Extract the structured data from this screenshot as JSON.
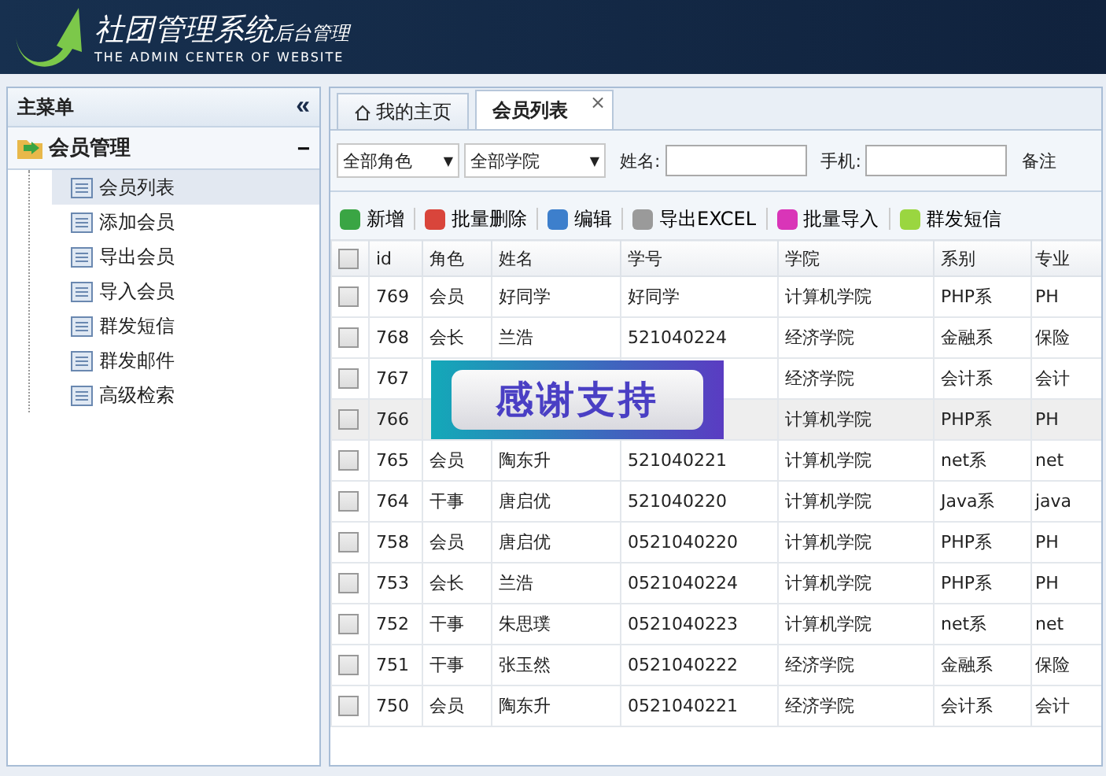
{
  "header": {
    "title": "社团管理系统",
    "subtitle": "后台管理",
    "tagline": "THE ADMIN CENTER OF WEBSITE"
  },
  "sidebar": {
    "title": "主菜单",
    "collapse": "«",
    "group": {
      "label": "会员管理",
      "expanded": true,
      "toggle": "−",
      "items": [
        {
          "label": "会员列表",
          "selected": true
        },
        {
          "label": "添加会员",
          "selected": false
        },
        {
          "label": "导出会员",
          "selected": false
        },
        {
          "label": "导入会员",
          "selected": false
        },
        {
          "label": "群发短信",
          "selected": false
        },
        {
          "label": "群发邮件",
          "selected": false
        },
        {
          "label": "高级检索",
          "selected": false
        }
      ]
    }
  },
  "tabs": [
    {
      "label": "我的主页",
      "selected": false,
      "kind": "home"
    },
    {
      "label": "会员列表",
      "selected": true,
      "kind": "closable",
      "close": "×"
    }
  ],
  "filters": {
    "role": "全部角色",
    "college": "全部学院",
    "caret": "▼",
    "name_label": "姓名:",
    "phone_label": "手机:",
    "note_label": "备注"
  },
  "toolbar": [
    {
      "label": "新增",
      "color": "#3aa544"
    },
    {
      "label": "批量删除",
      "color": "#d9453b"
    },
    {
      "label": "编辑",
      "color": "#3d7fcc"
    },
    {
      "label": "导出EXCEL",
      "color": "#9a9a9a"
    },
    {
      "label": "批量导入",
      "color": "#d935b8"
    },
    {
      "label": "群发短信",
      "color": "#9ad640"
    }
  ],
  "table": {
    "select_all": false,
    "columns": [
      "id",
      "角色",
      "姓名",
      "学号",
      "学院",
      "系别",
      "专业"
    ],
    "rows": [
      {
        "checked": false,
        "highlighted": false,
        "cells": [
          "769",
          "会员",
          "好同学",
          "好同学",
          "计算机学院",
          "PHP系",
          "PH"
        ]
      },
      {
        "checked": false,
        "highlighted": false,
        "cells": [
          "768",
          "会长",
          "兰浩",
          "521040224",
          "经济学院",
          "金融系",
          "保险"
        ]
      },
      {
        "checked": false,
        "highlighted": false,
        "cells": [
          "767",
          null,
          null,
          null,
          "经济学院",
          "会计系",
          "会计"
        ]
      },
      {
        "checked": false,
        "highlighted": true,
        "cells": [
          "766",
          null,
          null,
          null,
          "计算机学院",
          "PHP系",
          "PH"
        ]
      },
      {
        "checked": false,
        "highlighted": false,
        "cells": [
          "765",
          "会员",
          "陶东升",
          "521040221",
          "计算机学院",
          "net系",
          "net"
        ]
      },
      {
        "checked": false,
        "highlighted": false,
        "cells": [
          "764",
          "干事",
          "唐启优",
          "521040220",
          "计算机学院",
          "Java系",
          "java"
        ]
      },
      {
        "checked": false,
        "highlighted": false,
        "cells": [
          "758",
          "会员",
          "唐启优",
          "0521040220",
          "计算机学院",
          "PHP系",
          "PH"
        ]
      },
      {
        "checked": false,
        "highlighted": false,
        "cells": [
          "753",
          "会长",
          "兰浩",
          "0521040224",
          "计算机学院",
          "PHP系",
          "PH"
        ]
      },
      {
        "checked": false,
        "highlighted": false,
        "cells": [
          "752",
          "干事",
          "朱思璞",
          "0521040223",
          "计算机学院",
          "net系",
          "net"
        ]
      },
      {
        "checked": false,
        "highlighted": false,
        "cells": [
          "751",
          "干事",
          "张玉然",
          "0521040222",
          "经济学院",
          "金融系",
          "保险"
        ]
      },
      {
        "checked": false,
        "highlighted": false,
        "cells": [
          "750",
          "会员",
          "陶东升",
          "0521040221",
          "经济学院",
          "会计系",
          "会计"
        ]
      }
    ]
  },
  "toast": {
    "text": "感谢支持"
  }
}
